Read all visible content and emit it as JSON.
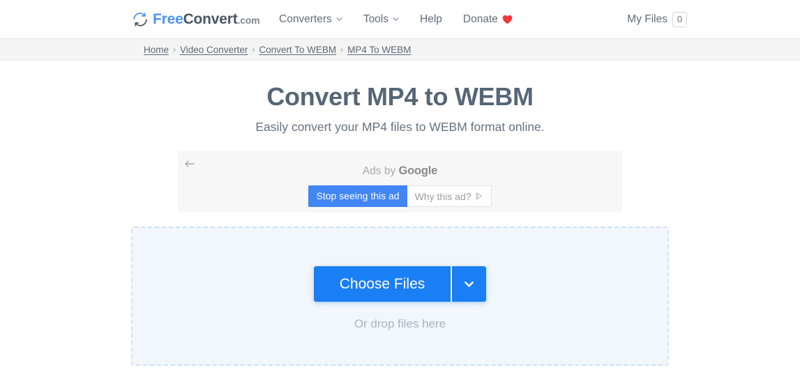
{
  "header": {
    "logo": {
      "icon": "refresh-circle-icon",
      "part_free": "Free",
      "part_convert": "Convert",
      "part_com": ".com"
    },
    "nav": [
      {
        "label": "Converters",
        "has_caret": true
      },
      {
        "label": "Tools",
        "has_caret": true
      },
      {
        "label": "Help",
        "has_caret": false
      },
      {
        "label": "Donate",
        "has_caret": false,
        "icon": "heart-icon"
      }
    ],
    "my_files": {
      "label": "My Files",
      "count": "0"
    }
  },
  "breadcrumb": {
    "separator": "›",
    "items": [
      {
        "label": "Home"
      },
      {
        "label": "Video Converter"
      },
      {
        "label": "Convert To WEBM"
      },
      {
        "label": "MP4 To WEBM"
      }
    ]
  },
  "hero": {
    "title": "Convert MP4 to WEBM",
    "subtitle": "Easily convert your MP4 files to WEBM format online."
  },
  "ad": {
    "back_arrow_icon": "arrow-left-icon",
    "ads_by_prefix": "Ads by ",
    "ads_by_brand": "Google",
    "stop_seeing_label": "Stop seeing this ad",
    "why_this_ad_label": "Why this ad?",
    "why_this_ad_icon": "ad-choices-icon"
  },
  "dropzone": {
    "choose_files_label": "Choose Files",
    "dropdown_icon": "chevron-down-icon",
    "drop_hint": "Or drop files here"
  },
  "colors": {
    "brand_blue": "#1a7ef5",
    "logo_blue": "#4d94f7",
    "google_ad_blue": "#4285f4",
    "heading_slate": "#566676",
    "dropzone_bg": "#f2f7fd",
    "dropzone_border": "#cfe0f7",
    "breadcrumb_bg": "#f4f4f4",
    "heart_red": "#f0373c"
  }
}
